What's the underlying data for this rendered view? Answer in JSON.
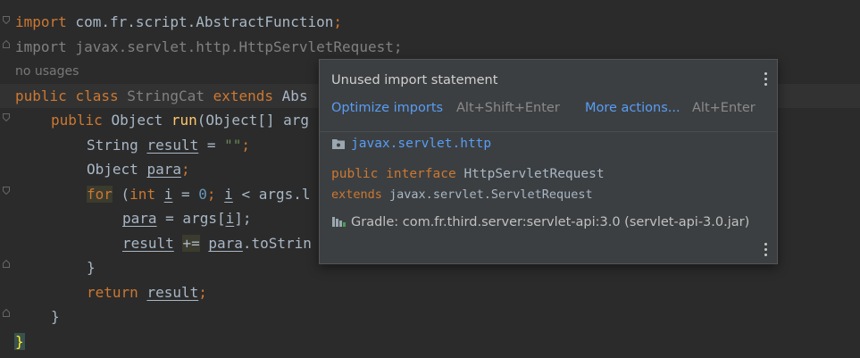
{
  "code": {
    "l1": {
      "kw": "import",
      "rest": " com.fr.script.AbstractFunction",
      "semi": ";"
    },
    "l2": {
      "kw": "import",
      "rest": " javax.servlet.http.HttpServletRequest;"
    },
    "usages": "no usages",
    "l3": {
      "kw1": "public",
      "kw2": "class",
      "name": "StringCat",
      "kw3": "extends",
      "rest": "Abs"
    },
    "l4": {
      "kw": "public",
      "type": "Object",
      "fn": "run",
      "rest": "(Object[] arg"
    },
    "l5": {
      "type": "String",
      "var": "result",
      "op": " = ",
      "str": "\"\"",
      "semi": ";"
    },
    "l6": {
      "type": "Object",
      "var": "para",
      "semi": ";"
    },
    "l7": {
      "kw": "for",
      "p1": " (",
      "kw2": "int",
      "var": "i",
      "op": " = ",
      "num": "0",
      "semi": "; ",
      "var2": "i",
      "rest": " < args.l"
    },
    "l8": {
      "var": "para",
      "op": " = args[",
      "idx": "i",
      "end": "];"
    },
    "l9": {
      "var": "result",
      "op": "+=",
      "var2": "para",
      "rest": ".toStrin"
    },
    "l10": {
      "brace": "}"
    },
    "l11": {
      "kw": "return",
      "var": "result",
      "semi": ";"
    },
    "l12": {
      "brace": "}"
    },
    "l13": {
      "brace": "}"
    }
  },
  "popup": {
    "title": "Unused import statement",
    "action1": {
      "label": "Optimize imports",
      "shortcut": "Alt+Shift+Enter"
    },
    "action2": {
      "label": "More actions...",
      "shortcut": "Alt+Enter"
    },
    "package": "javax.servlet.http",
    "decl_kw1": "public",
    "decl_kw2": "interface",
    "decl_name": "HttpServletRequest",
    "decl_kw3": "extends",
    "decl_super": "javax.servlet.ServletRequest",
    "gradle": "Gradle: com.fr.third.server:servlet-api:3.0 (servlet-api-3.0.jar)"
  },
  "colors": {
    "keyword": "#cc7832",
    "function": "#ffc66d",
    "string": "#6a8759",
    "link": "#589df6",
    "background": "#2b2b2b"
  },
  "icons": [
    "fold-icon",
    "package-folder-icon",
    "gradle-library-icon",
    "more-options-icon"
  ]
}
